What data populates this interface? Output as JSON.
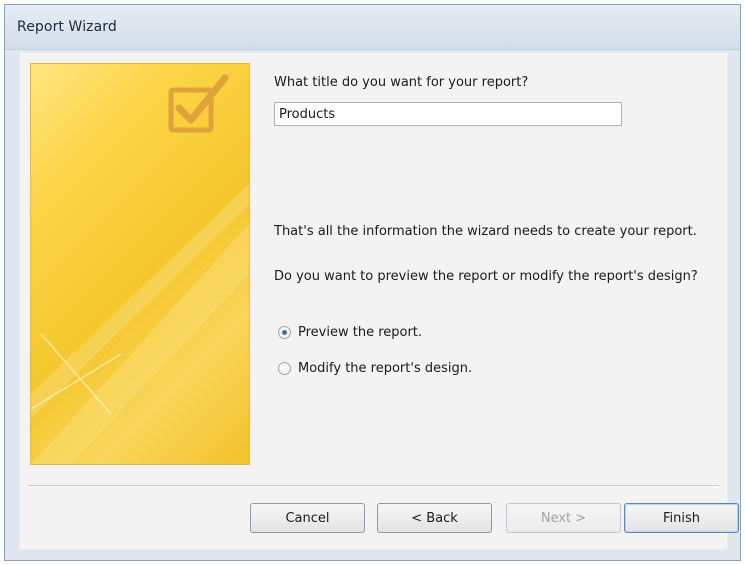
{
  "window": {
    "title": "Report Wizard"
  },
  "question": "What title do you want for your report?",
  "report_title": {
    "value": "Products"
  },
  "info_text": "That's all the information the wizard needs to create your report.",
  "preview_question": "Do you want to preview the report or modify the report's design?",
  "options": [
    {
      "label": "Preview the report.",
      "checked": true
    },
    {
      "label": "Modify the report's design.",
      "checked": false
    }
  ],
  "buttons": {
    "cancel": "Cancel",
    "back": "< Back",
    "next": "Next >",
    "finish": "Finish"
  },
  "banner": {
    "icon": "checkbox-check-icon",
    "color": "#f7c832"
  }
}
